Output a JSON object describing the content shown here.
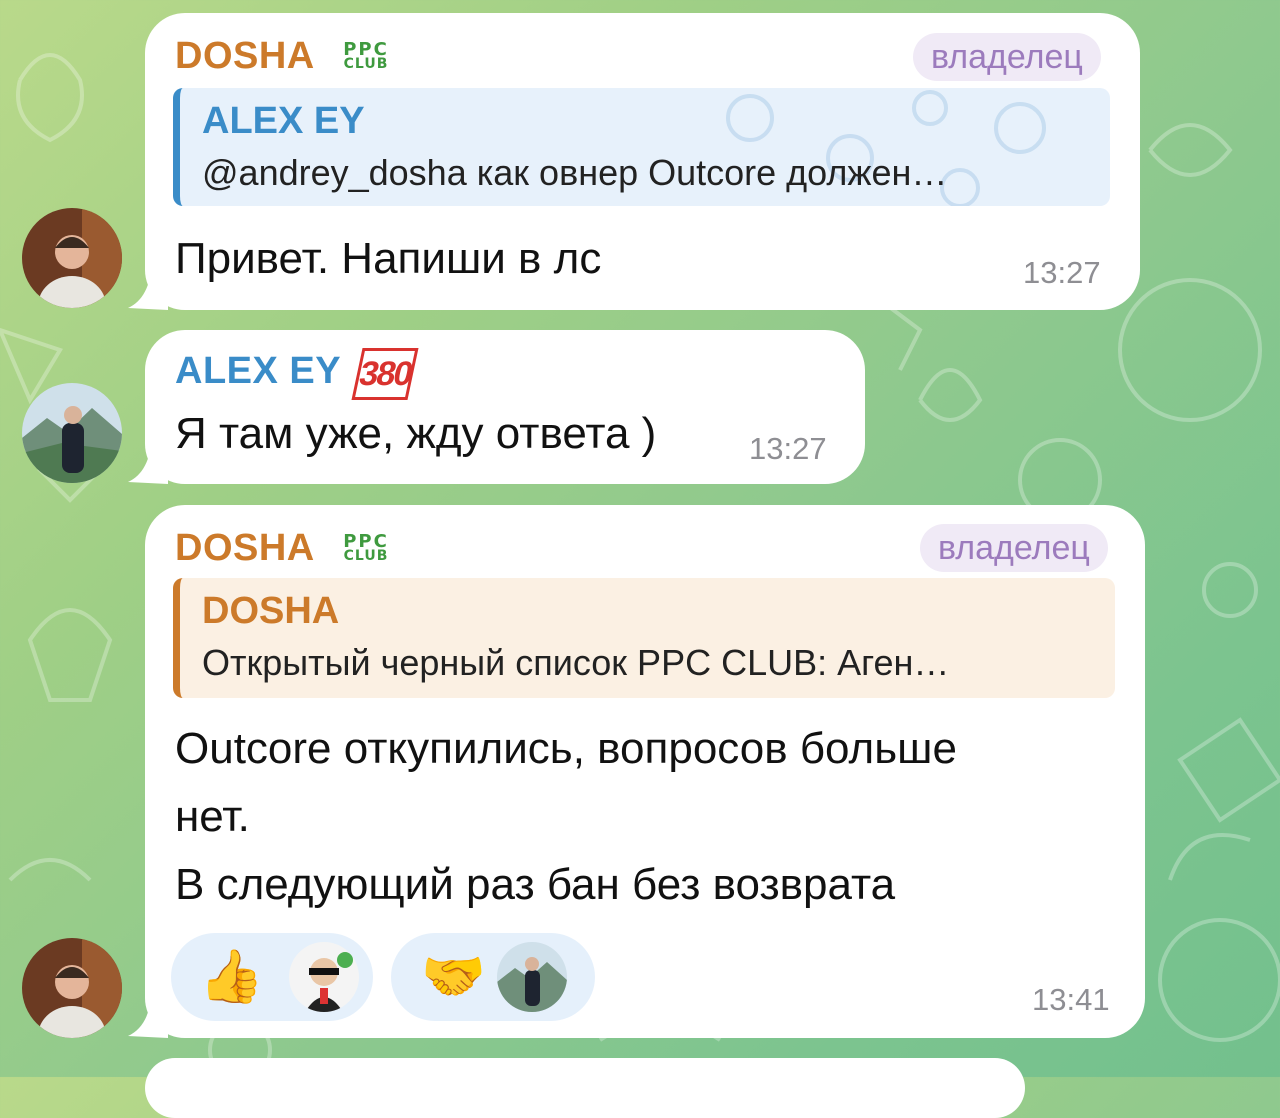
{
  "messages": [
    {
      "sender": "DOSHA",
      "sender_badge_line1": "PPC",
      "sender_badge_line2": "CLUB",
      "role": "владелец",
      "reply": {
        "name": "ALEX EY",
        "text": "@andrey_dosha как овнер Outcore должен…"
      },
      "text": "Привет.  Напиши в лс",
      "time": "13:27"
    },
    {
      "sender": "ALEX EY",
      "sender_badge": "380",
      "text": "Я там уже, жду ответа )",
      "time": "13:27"
    },
    {
      "sender": "DOSHA",
      "sender_badge_line1": "PPC",
      "sender_badge_line2": "CLUB",
      "role": "владелец",
      "reply": {
        "name": "DOSHA",
        "text": "Открытый черный список PPC CLUB: Аген…"
      },
      "text_lines": [
        "Outcore откупились, вопросов больше",
        "нет.",
        "В следующий раз бан без возврата"
      ],
      "reactions": [
        {
          "emoji": "👍",
          "icon": "thumbs-up-icon"
        },
        {
          "emoji": "🤝",
          "icon": "handshake-icon"
        }
      ],
      "time": "13:41"
    }
  ],
  "colors": {
    "orange_name": "#cc7a2a",
    "blue_name": "#3a8cc8",
    "badge_text": "#9c7bbd",
    "ppc_green": "#3f9a3f",
    "badge_380_red": "#d9322e"
  }
}
